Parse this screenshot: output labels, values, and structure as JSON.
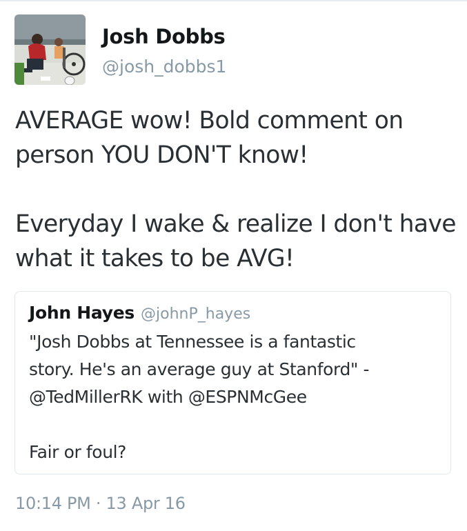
{
  "author": {
    "display_name": "Josh Dobbs",
    "handle": "@josh_dobbs1"
  },
  "tweet": {
    "paragraphs": [
      "AVERAGE wow! Bold comment on person YOU DON'T know!",
      "Everyday I wake & realize I don't have what it takes to be AVG!"
    ],
    "lines": [
      [
        "AVERAGE wow! Bold comment on",
        "person YOU DON'T know!"
      ],
      [
        "Everyday I wake & realize I don't have",
        "what it takes to be AVG!"
      ]
    ],
    "timestamp": "10:14 PM · 13 Apr 16"
  },
  "quoted_tweet": {
    "display_name": "John Hayes",
    "handle": "@johnP_hayes",
    "lines": [
      [
        "\"Josh Dobbs at Tennessee is a fantastic",
        "story. He's an average guy at Stanford\" -",
        "@TedMillerRK with @ESPNMcGee"
      ],
      [
        "Fair or foul?"
      ]
    ]
  },
  "colors": {
    "text_primary": "#14171a",
    "text_body": "#292f33",
    "text_secondary": "#8899a6",
    "border": "#e1e8ed"
  }
}
